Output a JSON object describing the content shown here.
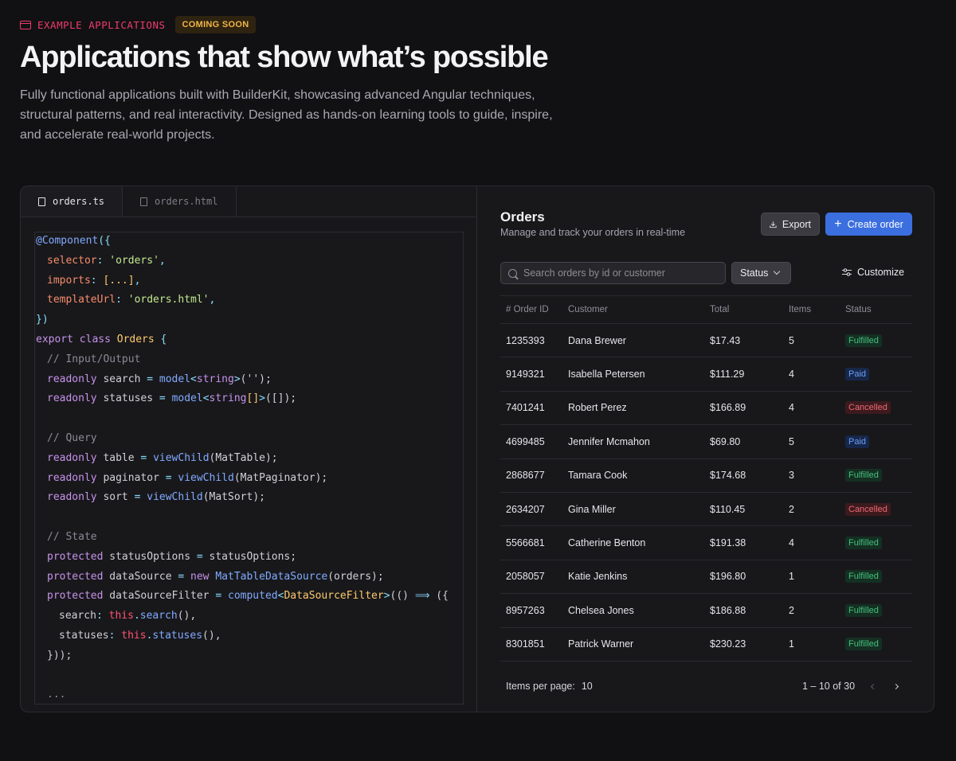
{
  "hero": {
    "eyebrow": "EXAMPLE APPLICATIONS",
    "badge": "COMING SOON",
    "title": "Applications that show what’s possible",
    "description": "Fully functional applications built with BuilderKit, showcasing advanced Angular techniques, structural patterns, and real interactivity. Designed as hands-on learning tools to guide, inspire, and accelerate real-world projects."
  },
  "code_tabs": [
    "orders.ts",
    "orders.html"
  ],
  "orders": {
    "title": "Orders",
    "subtitle": "Manage and track your orders in real-time",
    "export_label": "Export",
    "create_label": "Create order",
    "search_placeholder": "Search orders by id or customer",
    "status_filter": "Status",
    "customize_label": "Customize",
    "columns": [
      "# Order ID",
      "Customer",
      "Total",
      "Items",
      "Status"
    ],
    "rows": [
      {
        "id": "1235393",
        "customer": "Dana Brewer",
        "total": "$17.43",
        "items": "5",
        "status": "Fulfilled"
      },
      {
        "id": "9149321",
        "customer": "Isabella Petersen",
        "total": "$111.29",
        "items": "4",
        "status": "Paid"
      },
      {
        "id": "7401241",
        "customer": "Robert Perez",
        "total": "$166.89",
        "items": "4",
        "status": "Cancelled"
      },
      {
        "id": "4699485",
        "customer": "Jennifer Mcmahon",
        "total": "$69.80",
        "items": "5",
        "status": "Paid"
      },
      {
        "id": "2868677",
        "customer": "Tamara Cook",
        "total": "$174.68",
        "items": "3",
        "status": "Fulfilled"
      },
      {
        "id": "2634207",
        "customer": "Gina Miller",
        "total": "$110.45",
        "items": "2",
        "status": "Cancelled"
      },
      {
        "id": "5566681",
        "customer": "Catherine Benton",
        "total": "$191.38",
        "items": "4",
        "status": "Fulfilled"
      },
      {
        "id": "2058057",
        "customer": "Katie Jenkins",
        "total": "$196.80",
        "items": "1",
        "status": "Fulfilled"
      },
      {
        "id": "8957263",
        "customer": "Chelsea Jones",
        "total": "$186.88",
        "items": "2",
        "status": "Fulfilled"
      },
      {
        "id": "8301851",
        "customer": "Patrick Warner",
        "total": "$230.23",
        "items": "1",
        "status": "Fulfilled"
      }
    ],
    "items_per_page_label": "Items per page:",
    "items_per_page": "10",
    "range": "1 – 10 of 30"
  },
  "colors": {
    "background": "#111113",
    "accent_pink": "#ef3b6b",
    "primary": "#3b6fe0",
    "fulfilled": "#45c07c",
    "paid": "#6e9ef6",
    "cancelled": "#ef6a73"
  },
  "icons": [
    "window-icon",
    "file-icon",
    "download-icon",
    "plus-icon",
    "search-icon",
    "chevron-down-icon",
    "sliders-icon",
    "chevron-left-icon",
    "chevron-right-icon"
  ]
}
